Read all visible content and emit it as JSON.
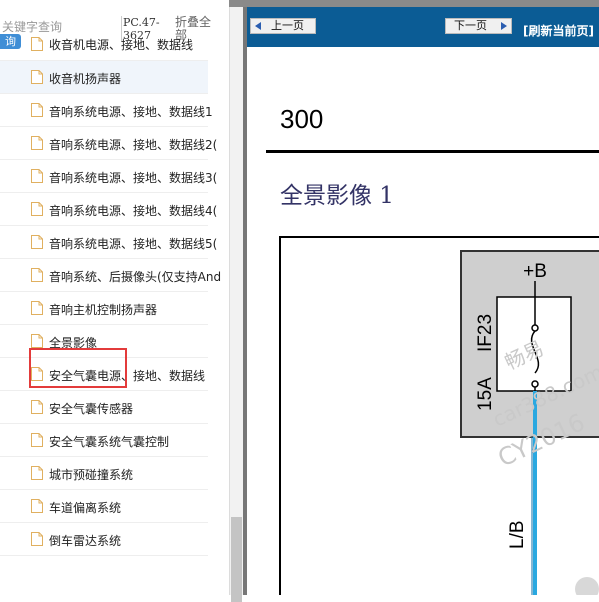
{
  "sidebar": {
    "search_placeholder": "关键字查询",
    "query_button": "询",
    "pc_code": "PC.47-3627",
    "collapse_all": "折叠全部",
    "items": [
      {
        "label": "收音机电源、接地、数据线"
      },
      {
        "label": "收音机扬声器"
      },
      {
        "label": "音响系统电源、接地、数据线1"
      },
      {
        "label": "音响系统电源、接地、数据线2("
      },
      {
        "label": "音响系统电源、接地、数据线3("
      },
      {
        "label": "音响系统电源、接地、数据线4("
      },
      {
        "label": "音响系统电源、接地、数据线5("
      },
      {
        "label": "音响系统、后摄像头(仅支持And"
      },
      {
        "label": "音响主机控制扬声器"
      },
      {
        "label": "全景影像"
      },
      {
        "label": "安全气囊电源、接地、数据线"
      },
      {
        "label": "安全气囊传感器"
      },
      {
        "label": "安全气囊系统气囊控制"
      },
      {
        "label": "城市预碰撞系统"
      },
      {
        "label": "车道偏离系统"
      },
      {
        "label": "倒车雷达系统"
      }
    ],
    "highlighted_index": 1,
    "selected_index": 9
  },
  "toolbar": {
    "prev_label": "上一页",
    "next_label": "下一页",
    "refresh_label": "[刷新当前页]"
  },
  "document": {
    "page_number": "300",
    "title": "全景影像 1",
    "fuse_supply": "+B",
    "fuse_name": "IF23",
    "fuse_rating": "15A",
    "wire_color": "L/B",
    "watermark_1": "畅易",
    "watermark_2": "car388.com",
    "watermark_3": "CY2016"
  },
  "colors": {
    "nav_bar": "#0b5c95",
    "query_button": "#3f8ed6",
    "selection_box": "#e33b3b",
    "wire": "#2aa8e0",
    "title_text": "#333366"
  }
}
